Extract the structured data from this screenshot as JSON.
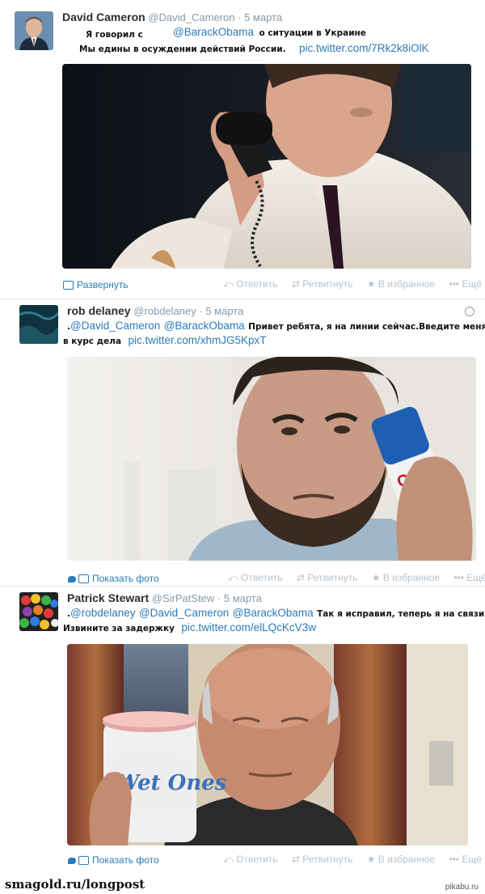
{
  "tweets": [
    {
      "name": "David Cameron",
      "handle": "@David_Cameron",
      "dot": "·",
      "time": "5 марта",
      "text_1": "Я говорил с",
      "mention_1": "@BarackObama",
      "text_2": "о ситуации в Украине",
      "text_3": "Мы едины в осуждении действий России.",
      "pic_link": "pic.twitter.com/7Rk2k8iOlK",
      "expand_label": "Развернуть"
    },
    {
      "name": "rob delaney",
      "handle": "@robdelaney",
      "dot": "·",
      "time": "5 марта",
      "prefix": ".",
      "mention_1": "@David_Cameron",
      "mention_2": "@BarackObama",
      "text_1": "Привет ребята, я на линии сейчас.Введите меня",
      "text_2": "в курс дела",
      "pic_link": "pic.twitter.com/xhmJG5KpxT",
      "expand_label": "Показать фото"
    },
    {
      "name": "Patrick Stewart",
      "handle": "@SirPatStew",
      "dot": "·",
      "time": "5 марта",
      "prefix": ".",
      "mention_1": "@robdelaney",
      "mention_2": "@David_Cameron",
      "mention_3": "@BarackObama",
      "text_1": "Так я исправил, теперь я на связи",
      "text_2": "Извините за задержку",
      "pic_link": "pic.twitter.com/elLQcKcV3w",
      "expand_label": "Показать фото",
      "wipes_brand": "Wet Ones"
    }
  ],
  "actions": {
    "reply": "Ответить",
    "retweet": "Ретвитнуть",
    "favorite": "В избранное",
    "more": "Ещё"
  },
  "footer": {
    "left": "smagold.ru/longpost",
    "right": "pikabu.ru"
  },
  "colors": {
    "link": "#2b7bb9",
    "muted": "#8899a6",
    "action": "#b8c3cc"
  }
}
